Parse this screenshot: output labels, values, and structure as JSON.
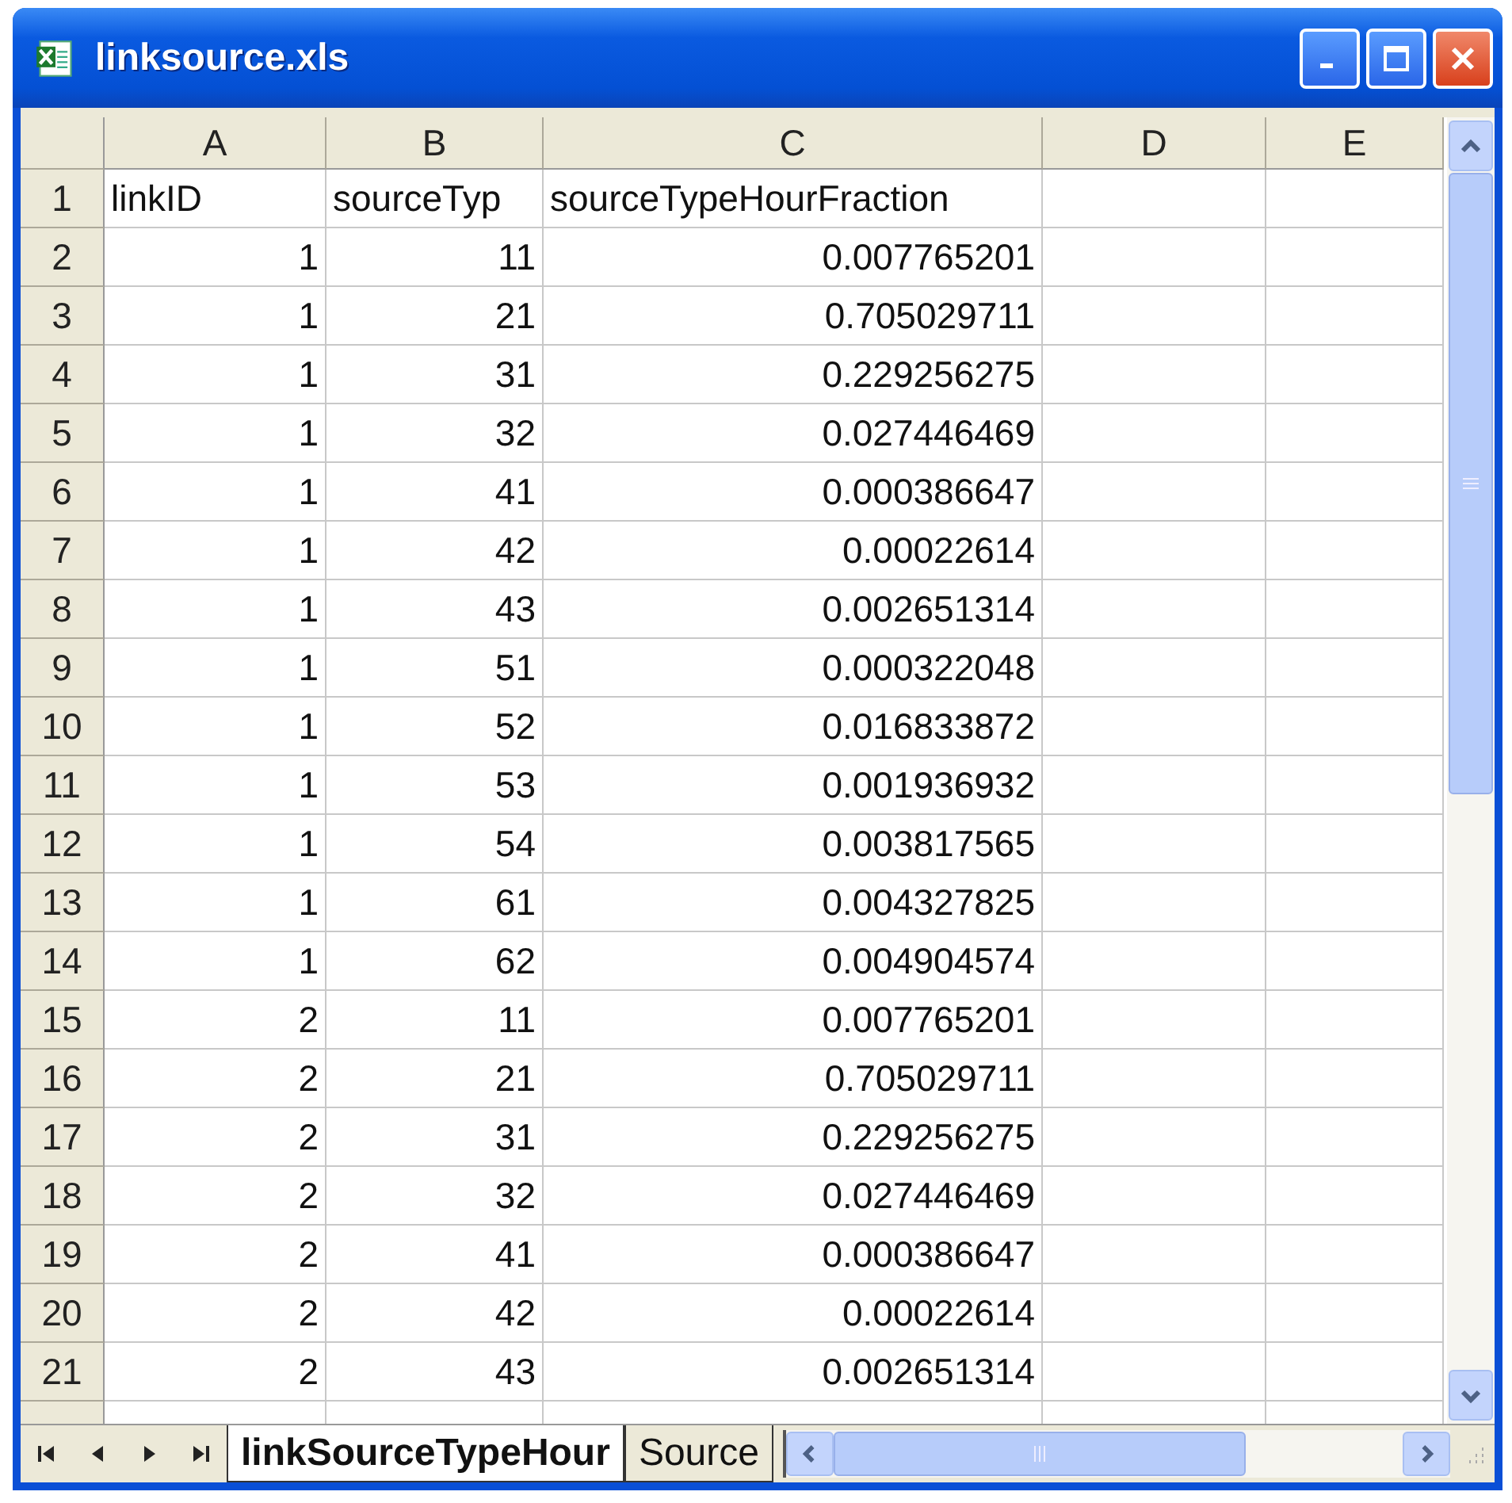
{
  "window": {
    "title": "linksource.xls"
  },
  "columns": [
    "A",
    "B",
    "C",
    "D",
    "E"
  ],
  "rows": [
    {
      "number": "1",
      "kind": "text",
      "cells": [
        "linkID",
        "sourceTyp",
        "sourceTypeHourFraction"
      ]
    },
    {
      "number": "2",
      "kind": "number",
      "cells": [
        "1",
        "11",
        "0.007765201"
      ]
    },
    {
      "number": "3",
      "kind": "number",
      "cells": [
        "1",
        "21",
        "0.705029711"
      ]
    },
    {
      "number": "4",
      "kind": "number",
      "cells": [
        "1",
        "31",
        "0.229256275"
      ]
    },
    {
      "number": "5",
      "kind": "number",
      "cells": [
        "1",
        "32",
        "0.027446469"
      ]
    },
    {
      "number": "6",
      "kind": "number",
      "cells": [
        "1",
        "41",
        "0.000386647"
      ]
    },
    {
      "number": "7",
      "kind": "number",
      "cells": [
        "1",
        "42",
        "0.00022614"
      ]
    },
    {
      "number": "8",
      "kind": "number",
      "cells": [
        "1",
        "43",
        "0.002651314"
      ]
    },
    {
      "number": "9",
      "kind": "number",
      "cells": [
        "1",
        "51",
        "0.000322048"
      ]
    },
    {
      "number": "10",
      "kind": "number",
      "cells": [
        "1",
        "52",
        "0.016833872"
      ]
    },
    {
      "number": "11",
      "kind": "number",
      "cells": [
        "1",
        "53",
        "0.001936932"
      ]
    },
    {
      "number": "12",
      "kind": "number",
      "cells": [
        "1",
        "54",
        "0.003817565"
      ]
    },
    {
      "number": "13",
      "kind": "number",
      "cells": [
        "1",
        "61",
        "0.004327825"
      ]
    },
    {
      "number": "14",
      "kind": "number",
      "cells": [
        "1",
        "62",
        "0.004904574"
      ]
    },
    {
      "number": "15",
      "kind": "number",
      "cells": [
        "2",
        "11",
        "0.007765201"
      ]
    },
    {
      "number": "16",
      "kind": "number",
      "cells": [
        "2",
        "21",
        "0.705029711"
      ]
    },
    {
      "number": "17",
      "kind": "number",
      "cells": [
        "2",
        "31",
        "0.229256275"
      ]
    },
    {
      "number": "18",
      "kind": "number",
      "cells": [
        "2",
        "32",
        "0.027446469"
      ]
    },
    {
      "number": "19",
      "kind": "number",
      "cells": [
        "2",
        "41",
        "0.000386647"
      ]
    },
    {
      "number": "20",
      "kind": "number",
      "cells": [
        "2",
        "42",
        "0.00022614"
      ]
    },
    {
      "number": "21",
      "kind": "number",
      "cells": [
        "2",
        "43",
        "0.002651314"
      ]
    }
  ],
  "sheet_tabs": [
    {
      "label": "linkSourceTypeHour",
      "selected": true
    },
    {
      "label": "Source",
      "selected": false
    }
  ]
}
